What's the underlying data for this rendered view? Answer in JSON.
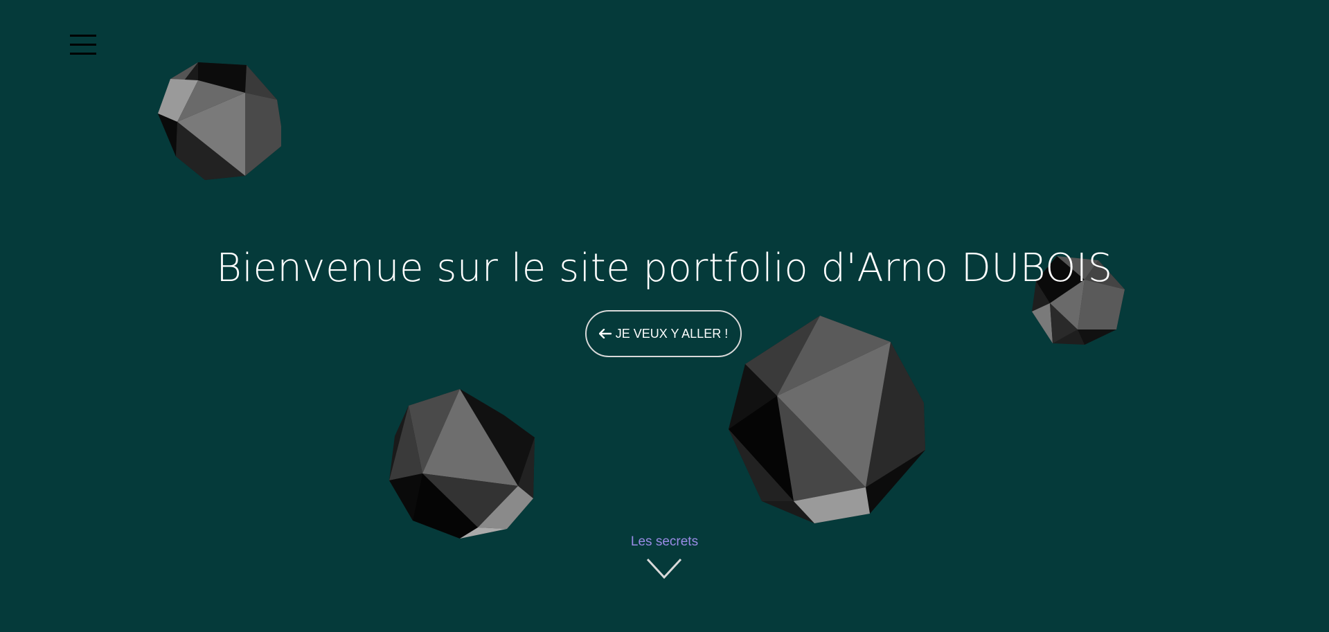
{
  "header": {
    "menu_icon": "hamburger-menu-icon"
  },
  "hero": {
    "title": "Bienvenue sur le site portfolio d'Arno DUBOIS",
    "cta_label": "JE VEUX Y ALLER !",
    "cta_icon": "arrow-left-icon"
  },
  "footer": {
    "secrets_label": "Les secrets",
    "scroll_icon": "chevron-down-icon"
  },
  "colors": {
    "background": "#053a3a",
    "title": "#ffffff",
    "secrets_label": "#9a8ce6",
    "button_border": "#d9d9d9"
  },
  "decorations": [
    "polyhedron-icon",
    "polyhedron-icon",
    "polyhedron-icon",
    "polyhedron-icon"
  ]
}
